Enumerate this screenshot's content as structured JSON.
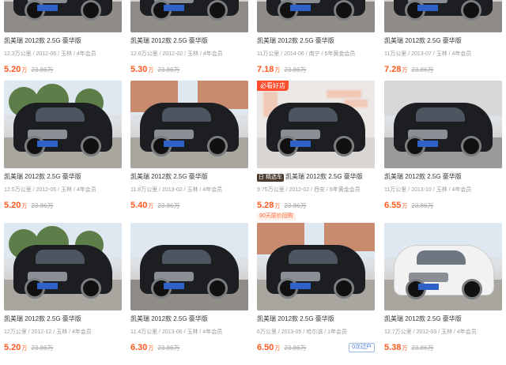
{
  "listings": [
    {
      "title": "凯美瑞 2012款 2.5G 豪华版",
      "meta": "12.3万公里 / 2012-06 / 玉林 / 4年会员",
      "price": "5.20",
      "unit": "万",
      "new_price": "23.86万",
      "tag": "",
      "badge": "",
      "extra": "",
      "oc": "",
      "scene": "dark"
    },
    {
      "title": "凯美瑞 2012款 2.5G 豪华版",
      "meta": "12.6万公里 / 2012-02 / 玉林 / 4年会员",
      "price": "5.30",
      "unit": "万",
      "new_price": "23.86万",
      "tag": "",
      "badge": "",
      "extra": "",
      "oc": "",
      "scene": "dark"
    },
    {
      "title": "凯美瑞 2012款 2.5G 豪华版",
      "meta": "11万公里 / 2014-06 / 南宁 / 5年黄金会员",
      "price": "7.18",
      "unit": "万",
      "new_price": "23.86万",
      "tag": "",
      "badge": "",
      "extra": "",
      "oc": "",
      "scene": "dark"
    },
    {
      "title": "凯美瑞 2012款 2.5G 豪华版",
      "meta": "11万公里 / 2013-07 / 玉林 / 4年会员",
      "price": "7.28",
      "unit": "万",
      "new_price": "23.86万",
      "tag": "",
      "badge": "",
      "extra": "",
      "oc": "",
      "scene": "dark"
    },
    {
      "title": "凯美瑞 2012款 2.5G 豪华版",
      "meta": "12.5万公里 / 2012-05 / 玉林 / 4年会员",
      "price": "5.20",
      "unit": "万",
      "new_price": "23.86万",
      "tag": "",
      "badge": "",
      "extra": "",
      "oc": "",
      "scene": "trees"
    },
    {
      "title": "凯美瑞 2012款 2.5G 豪华版",
      "meta": "11.8万公里 / 2013-02 / 玉林 / 4年会员",
      "price": "5.40",
      "unit": "万",
      "new_price": "23.86万",
      "tag": "",
      "badge": "",
      "extra": "",
      "oc": "",
      "scene": "building"
    },
    {
      "title": "凯美瑞 2012款 2.5G 豪华版",
      "meta": "9.75万公里 / 2012-02 / 西安 / 6年黄金会员",
      "price": "5.28",
      "unit": "万",
      "new_price": "23.86万",
      "tag": "必看好店",
      "badge": "日 精选车",
      "extra": "90天原价回购",
      "oc": "",
      "scene": "studio"
    },
    {
      "title": "凯美瑞 2012款 2.5G 豪华版",
      "meta": "11万公里 / 2013-10 / 玉林 / 4年会员",
      "price": "6.55",
      "unit": "万",
      "new_price": "23.86万",
      "tag": "",
      "badge": "",
      "extra": "",
      "oc": "",
      "scene": "lot"
    },
    {
      "title": "凯美瑞 2012款 2.5G 豪华版",
      "meta": "12万公里 / 2012-12 / 玉林 / 4年会员",
      "price": "5.20",
      "unit": "万",
      "new_price": "23.86万",
      "tag": "",
      "badge": "",
      "extra": "",
      "oc": "",
      "scene": "trees"
    },
    {
      "title": "凯美瑞 2012款 2.5G 豪华版",
      "meta": "11.4万公里 / 2013-06 / 玉林 / 4年会员",
      "price": "6.30",
      "unit": "万",
      "new_price": "23.86万",
      "tag": "",
      "badge": "",
      "extra": "",
      "oc": "",
      "scene": "dark"
    },
    {
      "title": "凯美瑞 2012款 2.5G 豪华版",
      "meta": "6万公里 / 2013-05 / 哈尔滨 / 1年会员",
      "price": "6.50",
      "unit": "万",
      "new_price": "23.86万",
      "tag": "",
      "badge": "",
      "extra": "",
      "oc": "0次过户",
      "scene": "building"
    },
    {
      "title": "凯美瑞 2012款 2.5G 豪华版",
      "meta": "12.7万公里 / 2012-03 / 玉林 / 4年会员",
      "price": "5.38",
      "unit": "万",
      "new_price": "23.86万",
      "tag": "",
      "badge": "",
      "extra": "",
      "oc": "",
      "scene": "white"
    }
  ]
}
